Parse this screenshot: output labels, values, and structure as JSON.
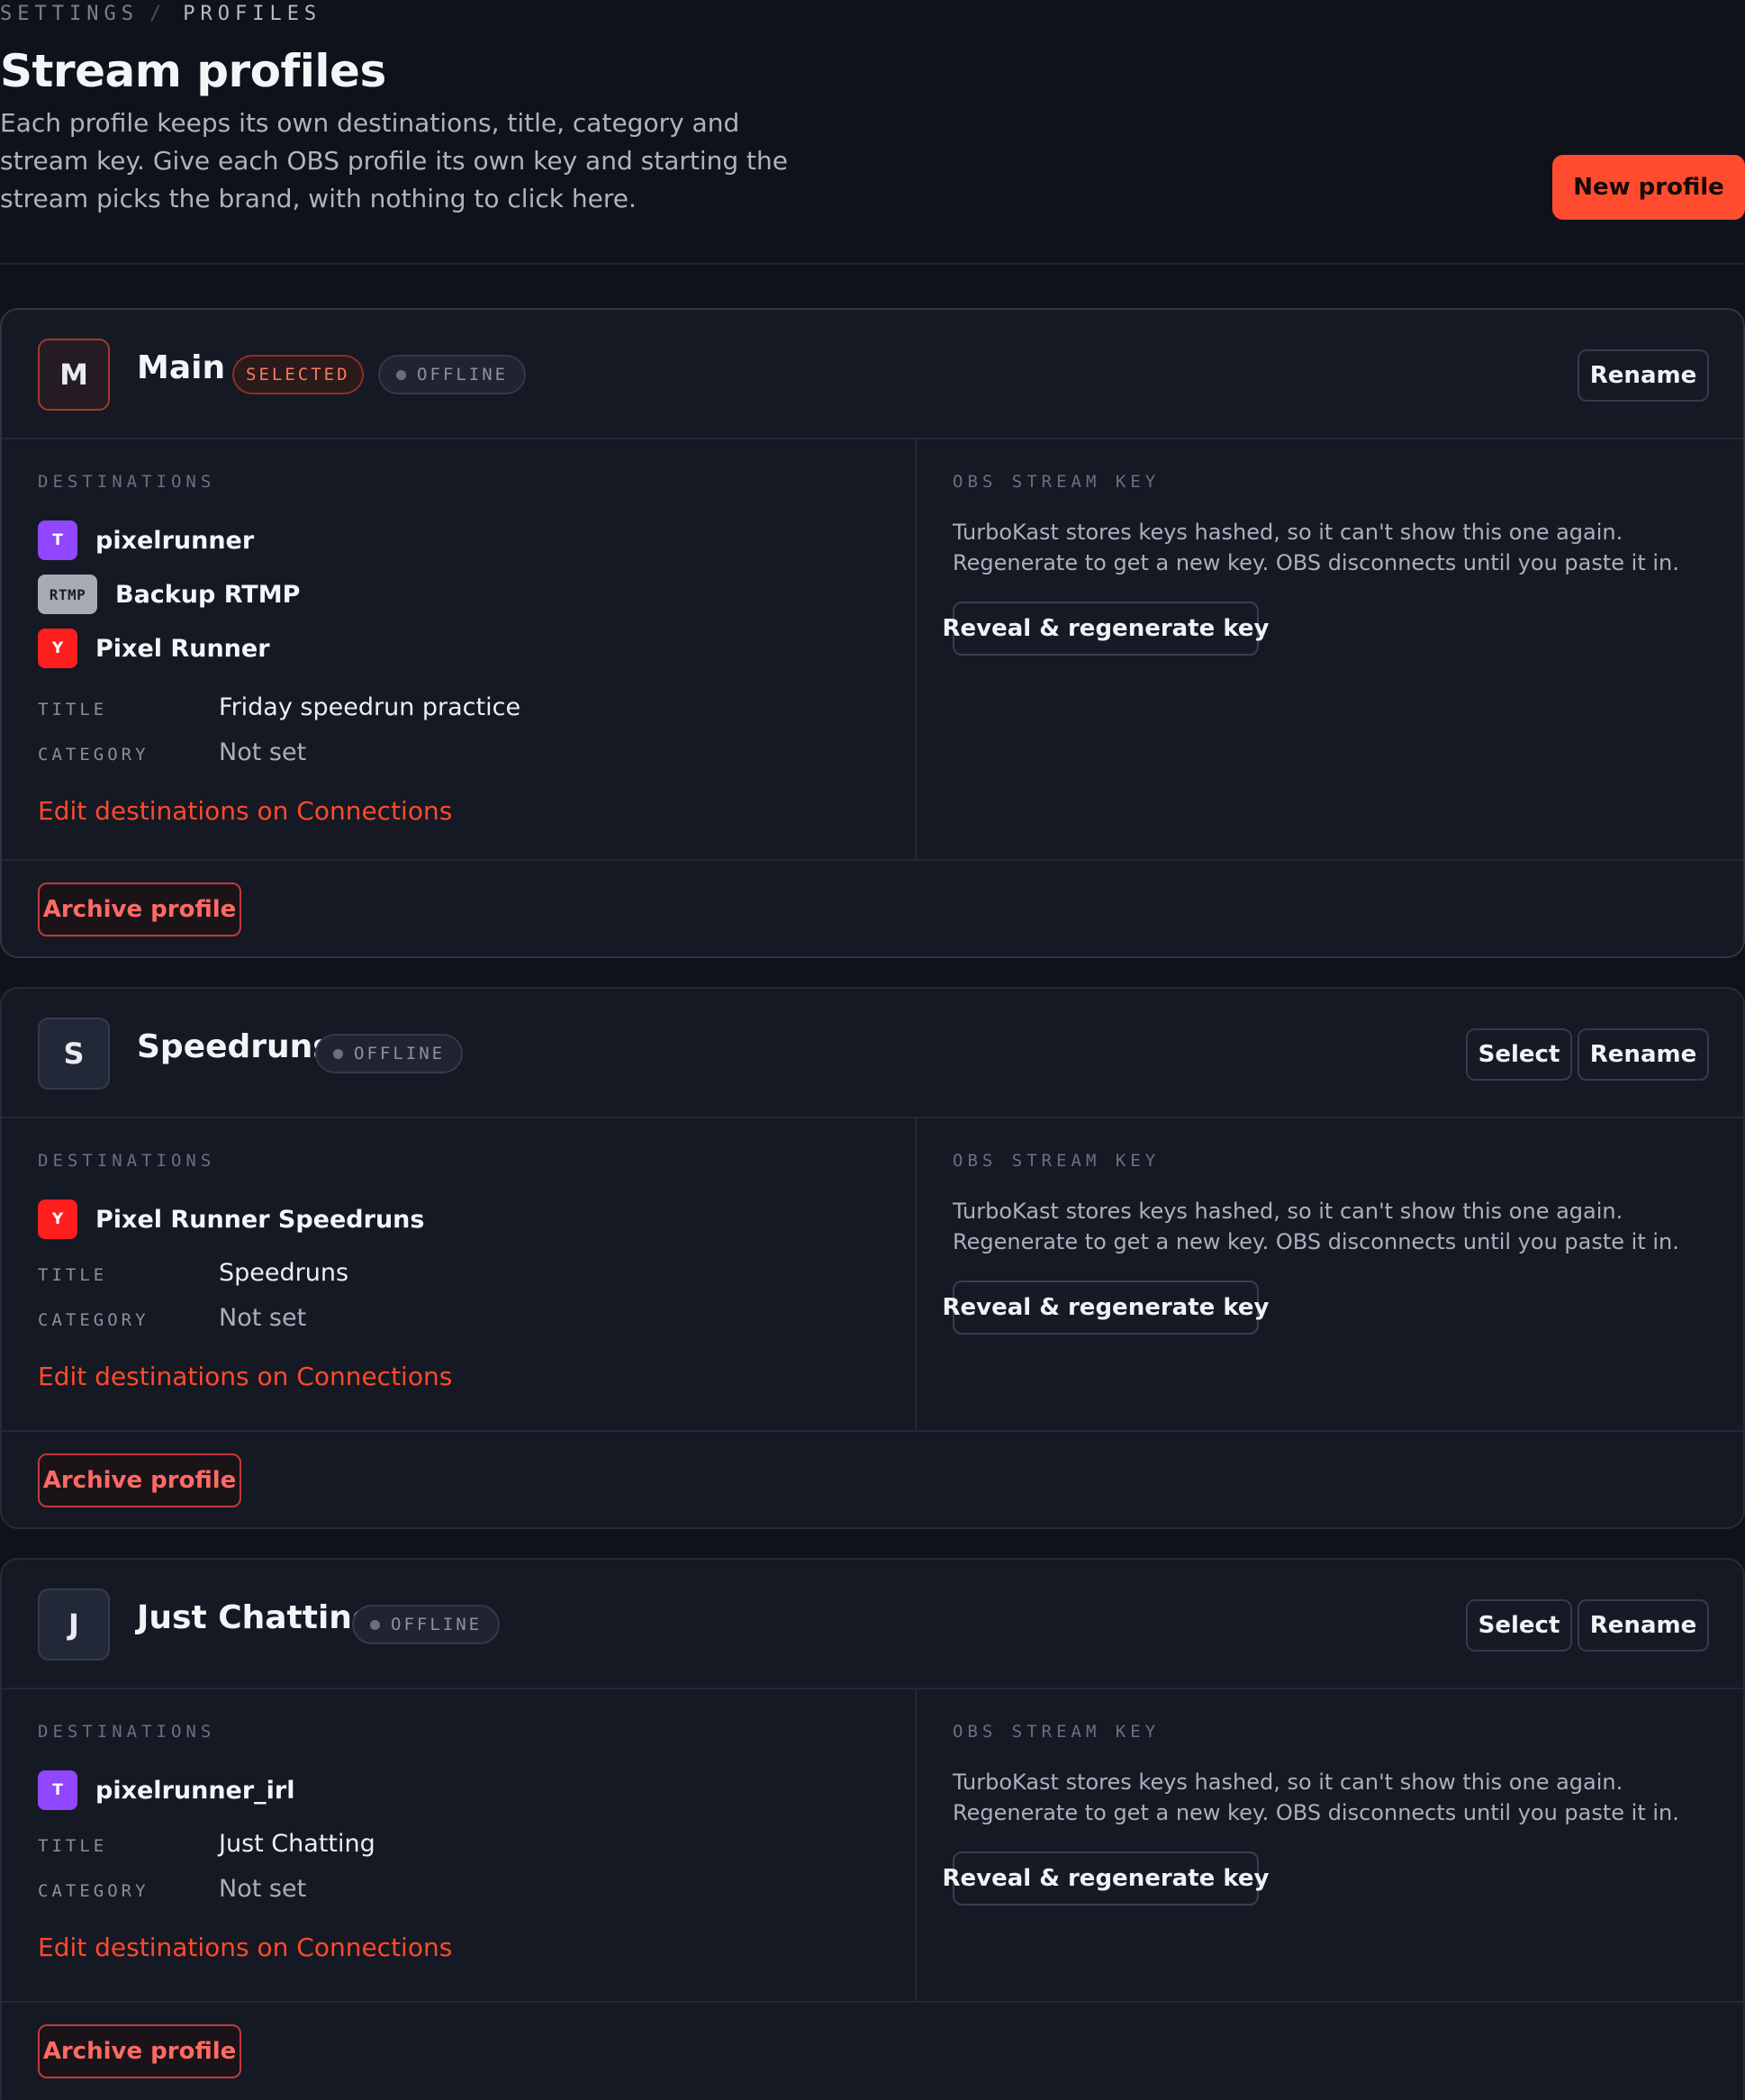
{
  "breadcrumb": {
    "root": "SETTINGS",
    "separator": "/",
    "current": "PROFILES"
  },
  "header": {
    "title": "Stream profiles",
    "description": "Each profile keeps its own destinations, title, category and stream key. Give each OBS profile its own key and starting the stream picks the brand, with nothing to click here.",
    "new_profile_label": "New profile"
  },
  "colors": {
    "accent": "#ff4c2e",
    "twitch": "#9146ff",
    "youtube": "#ff1e1e",
    "rtmp": "#a7abb6",
    "archive": "#ff6a64"
  },
  "profiles": [
    {
      "initial": "M",
      "name": "Main",
      "selected_badge": "SELECTED",
      "status": "OFFLINE",
      "select_label": "",
      "rename_label": "Rename",
      "destinations_label": "DESTINATIONS",
      "destinations": [
        {
          "platform": "twitch",
          "icon": "T",
          "name": "pixelrunner"
        },
        {
          "platform": "rtmp",
          "icon": "RTMP",
          "name": "Backup RTMP"
        },
        {
          "platform": "youtube",
          "icon": "Y",
          "name": "Pixel Runner"
        }
      ],
      "title_label": "TITLE",
      "title": "Friday speedrun practice",
      "category_label": "CATEGORY",
      "category": "Not set",
      "edit_link": "Edit destinations on Connections",
      "key_label": "OBS STREAM KEY",
      "key_description": "TurboKast stores keys hashed, so it can't show this one again. Regenerate to get a new key. OBS disconnects until you paste it in.",
      "reveal_label": "Reveal & regenerate key",
      "archive_label": "Archive profile"
    },
    {
      "initial": "S",
      "name": "Speedruns",
      "status": "OFFLINE",
      "select_label": "Select",
      "rename_label": "Rename",
      "destinations_label": "DESTINATIONS",
      "destinations": [
        {
          "platform": "youtube",
          "icon": "Y",
          "name": "Pixel Runner Speedruns"
        }
      ],
      "title_label": "TITLE",
      "title": "Speedruns",
      "category_label": "CATEGORY",
      "category": "Not set",
      "edit_link": "Edit destinations on Connections",
      "key_label": "OBS STREAM KEY",
      "key_description": "TurboKast stores keys hashed, so it can't show this one again. Regenerate to get a new key. OBS disconnects until you paste it in.",
      "reveal_label": "Reveal & regenerate key",
      "archive_label": "Archive profile"
    },
    {
      "initial": "J",
      "name": "Just Chatting",
      "status": "OFFLINE",
      "select_label": "Select",
      "rename_label": "Rename",
      "destinations_label": "DESTINATIONS",
      "destinations": [
        {
          "platform": "twitch",
          "icon": "T",
          "name": "pixelrunner_irl"
        }
      ],
      "title_label": "TITLE",
      "title": "Just Chatting",
      "category_label": "CATEGORY",
      "category": "Not set",
      "edit_link": "Edit destinations on Connections",
      "key_label": "OBS STREAM KEY",
      "key_description": "TurboKast stores keys hashed, so it can't show this one again. Regenerate to get a new key. OBS disconnects until you paste it in.",
      "reveal_label": "Reveal & regenerate key",
      "archive_label": "Archive profile"
    }
  ]
}
